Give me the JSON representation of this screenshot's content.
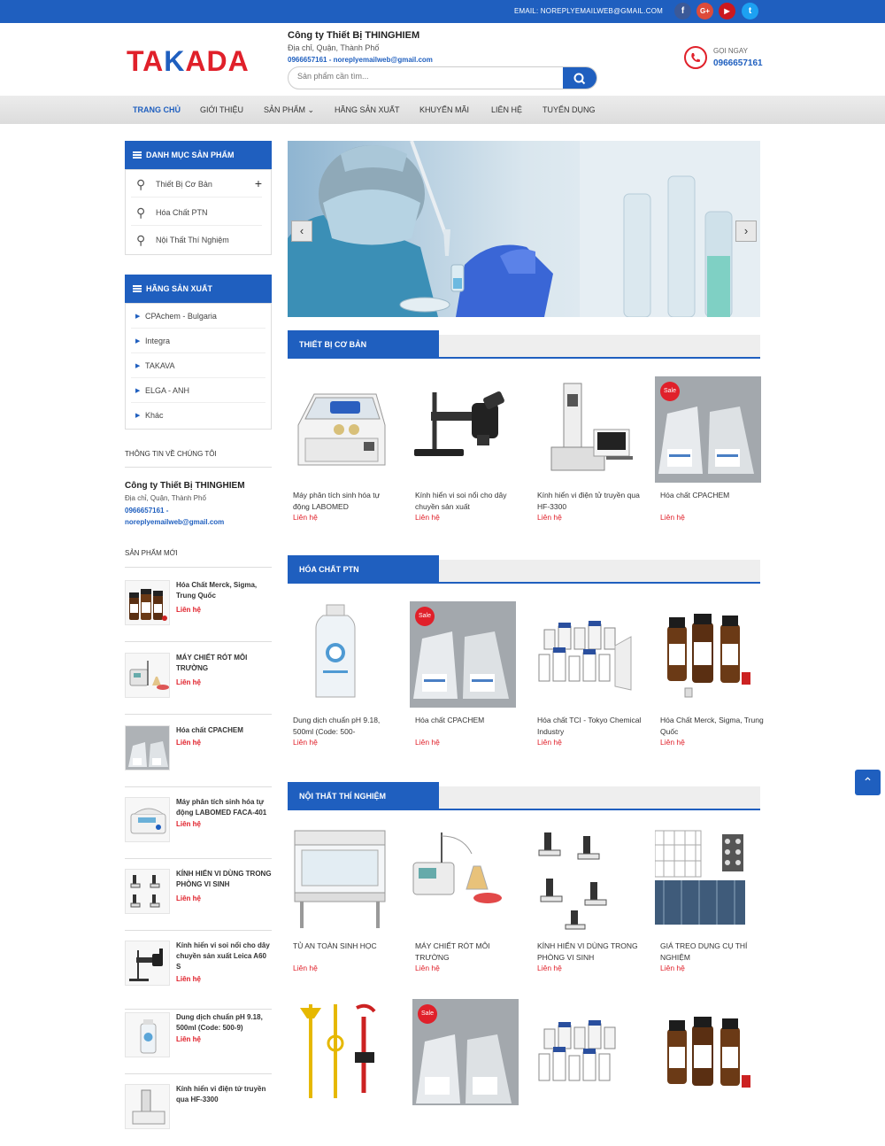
{
  "topbar": {
    "email": "EMAIL: NOREPLYEMAILWEB@GMAIL.COM",
    "social": [
      {
        "icon": "facebook-icon",
        "glyph": "f",
        "color": "#3b5998"
      },
      {
        "icon": "google-plus-icon",
        "glyph": "G+",
        "color": "#dd4b39"
      },
      {
        "icon": "youtube-icon",
        "glyph": "▶",
        "color": "#cc181e"
      },
      {
        "icon": "twitter-icon",
        "glyph": "t",
        "color": "#1da1f2"
      }
    ]
  },
  "header": {
    "logo": {
      "part1": "TA",
      "part2": "K",
      "part3": "ADA"
    },
    "company_name": "Công ty Thiết Bị THINGHIEM",
    "address": "Địa chỉ, Quận, Thành Phố",
    "phone": "0966657161",
    "email": "noreplyemailweb@gmail.com",
    "search_placeholder": "Sản phẩm cần tìm...",
    "call_label": "GỌI NGAY",
    "call_number": "0966657161"
  },
  "nav": {
    "items": [
      "TRANG CHỦ",
      "GIỚI THIỆU",
      "SẢN PHẨM ⌄",
      "HÃNG SẢN XUẤT",
      "KHUYẾN MÃI",
      "LIÊN HỆ",
      "TUYỂN DỤNG"
    ]
  },
  "sidebar": {
    "categories_title": "DANH MỤC SẢN PHẨM",
    "categories": [
      "Thiết Bị Cơ Bản",
      "Hóa Chất PTN",
      "Nội Thất Thí Nghiệm"
    ],
    "brands_title": "HÃNG SẢN XUẤT",
    "brands": [
      "CPAchem - Bulgaria",
      "Integra",
      "TAKAVA",
      "ELGA - ANH",
      "Khác"
    ],
    "about_title": "THÔNG TIN VỀ CHÚNG TÔI",
    "about_name": "Công ty Thiết Bị THINGHIEM",
    "about_address": "Địa chỉ, Quận, Thành Phố",
    "about_phone": "0966657161 -",
    "about_email": "noreplyemailweb@gmail.com",
    "new_title": "SẢN PHẨM MỚI",
    "new_products": [
      {
        "name": "Hóa Chất Merck, Sigma, Trung Quốc",
        "price": "Liên hệ"
      },
      {
        "name": "MÁY CHIẾT RÓT MÔI TRƯỜNG",
        "price": "Liên hệ"
      },
      {
        "name": "Hóa chất CPACHEM",
        "price": "Liên hệ"
      },
      {
        "name": "Máy phân tích sinh hóa tự động LABOMED FACA-401",
        "price": "Liên hệ"
      },
      {
        "name": "KÍNH HIỂN VI DÙNG TRONG PHÒNG VI SINH",
        "price": "Liên hệ"
      },
      {
        "name": "Kính hiển vi soi nổi cho dây chuyền sản xuất Leica A60 S",
        "price": "Liên hệ"
      },
      {
        "name": "Dung dịch chuẩn pH 9.18, 500ml (Code: 500-9)",
        "price": "Liên hệ"
      },
      {
        "name": "Kính hiển vi điện tử truyền qua HF-3300",
        "price": ""
      }
    ]
  },
  "sections": [
    {
      "title": "THIẾT BỊ CƠ BẢN",
      "products": [
        {
          "name": "Máy phân tích sinh hóa tự động LABOMED",
          "price": "Liên hệ",
          "sale": ""
        },
        {
          "name": "Kính hiển vi soi nổi cho dây chuyền sản xuất",
          "price": "Liên hệ",
          "sale": ""
        },
        {
          "name": "Kính hiển vi điện tử truyền qua HF-3300",
          "price": "Liên hệ",
          "sale": ""
        },
        {
          "name": "Hóa chất CPACHEM",
          "price": "Liên hệ",
          "sale": "Sale"
        }
      ]
    },
    {
      "title": "HÓA CHẤT PTN",
      "products": [
        {
          "name": "Dung dịch chuẩn pH 9.18, 500ml (Code: 500-",
          "price": "Liên hệ",
          "sale": ""
        },
        {
          "name": "Hóa chất CPACHEM",
          "price": "Liên hệ",
          "sale": "Sale"
        },
        {
          "name": "Hóa chất TCI - Tokyo Chemical Industry",
          "price": "Liên hệ",
          "sale": ""
        },
        {
          "name": "Hóa Chất Merck, Sigma, Trung Quốc",
          "price": "Liên hệ",
          "sale": ""
        }
      ]
    },
    {
      "title": "NỘI THẤT THÍ NGHIỆM",
      "products": [
        {
          "name": "TỦ AN TOÀN SINH HỌC",
          "price": "Liên hệ",
          "sale": ""
        },
        {
          "name": "MÁY CHIẾT RÓT MÔI TRƯỜNG",
          "price": "Liên hệ",
          "sale": ""
        },
        {
          "name": "KÍNH HIỂN VI DÙNG TRONG PHÒNG VI SINH",
          "price": "Liên hệ",
          "sale": ""
        },
        {
          "name": "GIÁ TREO DỤNG CỤ THÍ NGHIỆM",
          "price": "Liên hệ",
          "sale": ""
        },
        {
          "name": "",
          "price": "",
          "sale": ""
        },
        {
          "name": "",
          "price": "",
          "sale": "Sale"
        },
        {
          "name": "",
          "price": "",
          "sale": ""
        },
        {
          "name": "",
          "price": "",
          "sale": ""
        }
      ]
    }
  ],
  "banner": {
    "prev": "‹",
    "next": "›"
  },
  "back_to_top": "⌃"
}
